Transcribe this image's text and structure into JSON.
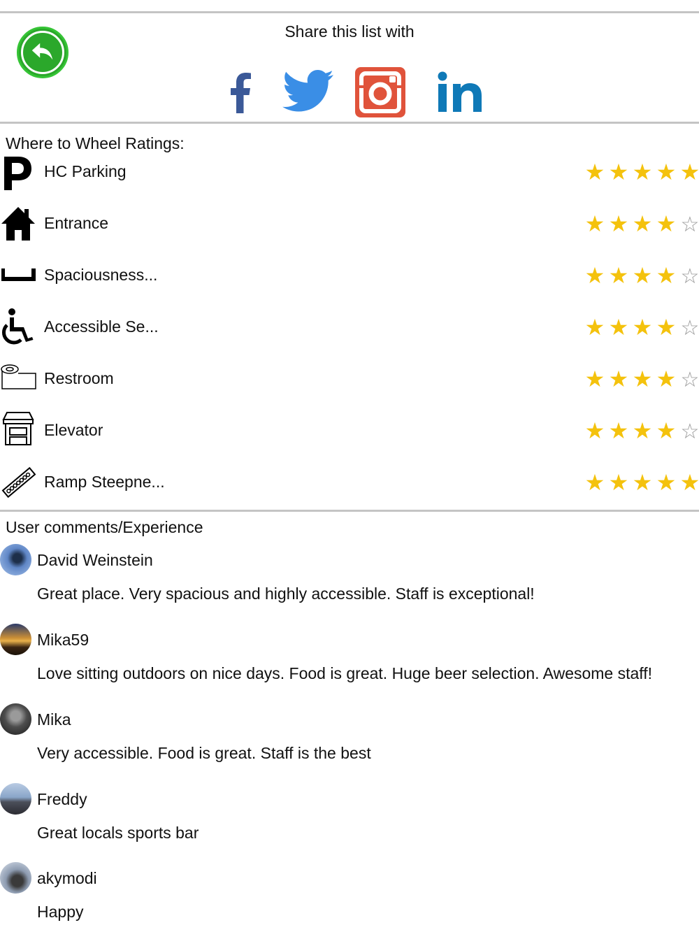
{
  "share": {
    "title": "Share this list with",
    "services": [
      "facebook-icon",
      "twitter-icon",
      "instagram-icon",
      "linkedin-icon"
    ],
    "colors": {
      "facebook": "#3b5998",
      "twitter": "#3a8ee6",
      "instagram": "#e0533b",
      "linkedin": "#0f79b7",
      "back": "#2ba82b"
    }
  },
  "ratings": {
    "title": "Where to Wheel Ratings:",
    "items": [
      {
        "label": "HC Parking",
        "icon": "parking-icon",
        "stars": 5
      },
      {
        "label": "Entrance",
        "icon": "house-icon",
        "stars": 4
      },
      {
        "label": "Spaciousness...",
        "icon": "width-icon",
        "stars": 4
      },
      {
        "label": "Accessible Se...",
        "icon": "wheelchair-icon",
        "stars": 4
      },
      {
        "label": "Restroom",
        "icon": "toilet-paper-icon",
        "stars": 4
      },
      {
        "label": "Elevator",
        "icon": "elevator-icon",
        "stars": 4
      },
      {
        "label": "Ramp Steepne...",
        "icon": "ramp-icon",
        "stars": 5
      }
    ],
    "star_color": "#f4c20d"
  },
  "comments": {
    "title": "User comments/Experience",
    "items": [
      {
        "name": "David Weinstein",
        "text": "Great place. Very spacious and highly accessible. Staff is exceptional!"
      },
      {
        "name": "Mika59",
        "text": "Love sitting outdoors on nice days. Food is great. Huge beer selection. Awesome staff!"
      },
      {
        "name": "Mika",
        "text": "Very accessible. Food is great. Staff is the best"
      },
      {
        "name": "Freddy",
        "text": "Great locals sports bar"
      },
      {
        "name": "akymodi",
        "text": "Happy"
      }
    ]
  }
}
